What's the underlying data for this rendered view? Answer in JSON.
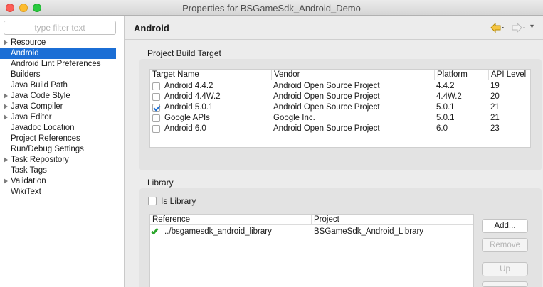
{
  "window": {
    "title": "Properties for BSGameSdk_Android_Demo"
  },
  "sidebar": {
    "filter_placeholder": "type filter text",
    "items": [
      {
        "label": "Resource",
        "expandable": true
      },
      {
        "label": "Android",
        "selected": true
      },
      {
        "label": "Android Lint Preferences"
      },
      {
        "label": "Builders"
      },
      {
        "label": "Java Build Path"
      },
      {
        "label": "Java Code Style",
        "expandable": true
      },
      {
        "label": "Java Compiler",
        "expandable": true
      },
      {
        "label": "Java Editor",
        "expandable": true
      },
      {
        "label": "Javadoc Location"
      },
      {
        "label": "Project References"
      },
      {
        "label": "Run/Debug Settings"
      },
      {
        "label": "Task Repository",
        "expandable": true
      },
      {
        "label": "Task Tags"
      },
      {
        "label": "Validation",
        "expandable": true
      },
      {
        "label": "WikiText"
      }
    ]
  },
  "page": {
    "title": "Android",
    "nav_menu": "▾"
  },
  "build_target": {
    "label": "Project Build Target",
    "columns": [
      "Target Name",
      "Vendor",
      "Platform",
      "API Level"
    ],
    "rows": [
      {
        "name": "Android 4.4.2",
        "vendor": "Android Open Source Project",
        "platform": "4.4.2",
        "api": "19",
        "checked": false
      },
      {
        "name": "Android 4.4W.2",
        "vendor": "Android Open Source Project",
        "platform": "4.4W.2",
        "api": "20",
        "checked": false
      },
      {
        "name": "Android 5.0.1",
        "vendor": "Android Open Source Project",
        "platform": "5.0.1",
        "api": "21",
        "checked": true
      },
      {
        "name": "Google APIs",
        "vendor": "Google Inc.",
        "platform": "5.0.1",
        "api": "21",
        "checked": false
      },
      {
        "name": "Android 6.0",
        "vendor": "Android Open Source Project",
        "platform": "6.0",
        "api": "23",
        "checked": false
      }
    ]
  },
  "library": {
    "label": "Library",
    "is_library_label": "Is Library",
    "columns": [
      "Reference",
      "Project"
    ],
    "rows": [
      {
        "reference": "../bsgamesdk_android_library",
        "project": "BSGameSdk_Android_Library"
      }
    ],
    "buttons": {
      "add": "Add...",
      "remove": "Remove",
      "up": "Up"
    }
  },
  "colors": {
    "accent": "#1b6ed5",
    "nav_arrow": "#e6a100"
  }
}
